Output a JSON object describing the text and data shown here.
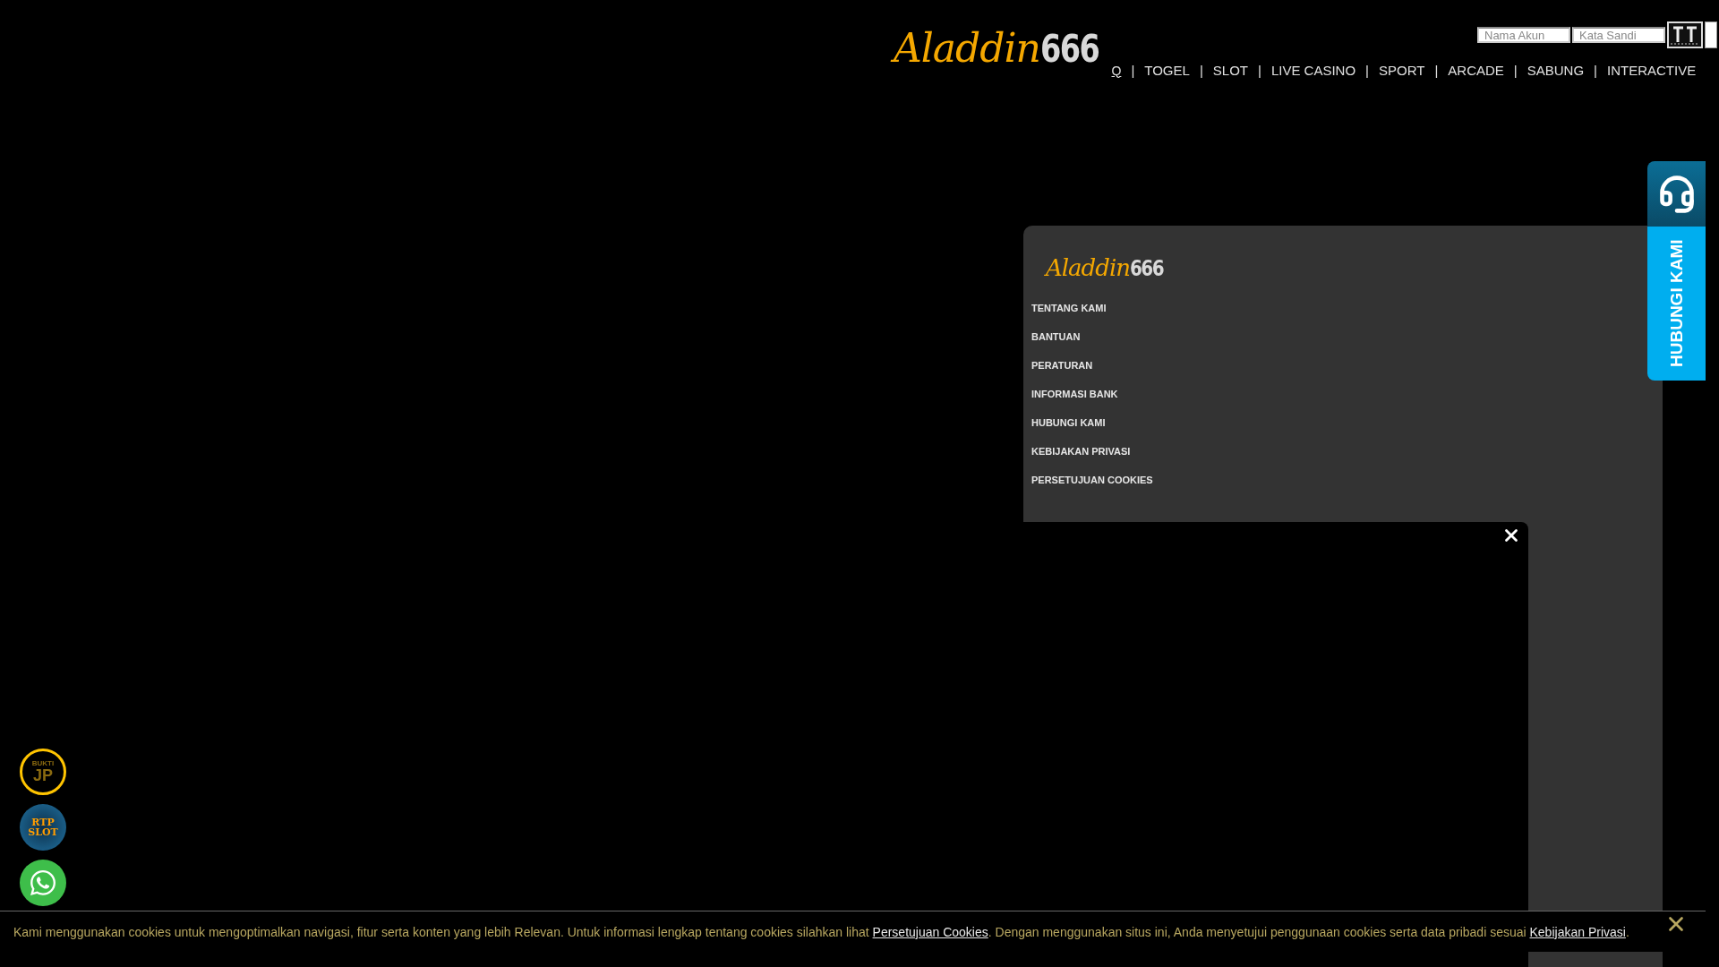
{
  "header": {
    "logo": {
      "script": "Aladdin",
      "number": "666"
    },
    "login": {
      "username_placeholder": "Nama Akun",
      "password_placeholder": "Kata Sandi"
    },
    "nav": [
      {
        "kind": "link",
        "label": "Q"
      },
      {
        "kind": "separator",
        "label": "|"
      },
      {
        "kind": "link",
        "label": "TOGEL"
      },
      {
        "kind": "separator",
        "label": "|"
      },
      {
        "kind": "link",
        "label": "SLOT"
      },
      {
        "kind": "separator",
        "label": "|"
      },
      {
        "kind": "link",
        "label": "LIVE CASINO"
      },
      {
        "kind": "separator",
        "label": "|"
      },
      {
        "kind": "link",
        "label": "SPORT"
      },
      {
        "kind": "separator",
        "label": "|"
      },
      {
        "kind": "link",
        "label": "ARCADE"
      },
      {
        "kind": "separator",
        "label": "|"
      },
      {
        "kind": "link",
        "label": "SABUNG"
      },
      {
        "kind": "separator",
        "label": "|"
      },
      {
        "kind": "link",
        "label": "INTERACTIVE"
      }
    ]
  },
  "footer": {
    "logo": {
      "script": "Aladdin",
      "number": "666"
    },
    "links": [
      "TENTANG KAMI",
      "BANTUAN",
      "PERATURAN",
      "INFORMASI BANK",
      "HUBUNGI KAMI",
      "KEBIJAKAN PRIVASI",
      "PERSETUJUAN COOKIES"
    ]
  },
  "side_tab": {
    "label": "HUBUNGI KAMI"
  },
  "floating_buttons": [
    {
      "kind": "bukti",
      "lines": [
        "BUKTI",
        "JP"
      ]
    },
    {
      "kind": "rtp",
      "lines": [
        "RTP",
        "SLOT"
      ]
    },
    {
      "kind": "whatsapp"
    }
  ],
  "cookie_notice": {
    "segments": [
      {
        "kind": "text",
        "text": "Kami menggunakan cookies untuk mengoptimalkan navigasi, fitur serta konten yang lebih Relevan. Untuk informasi lengkap tentang cookies silahkan lihat "
      },
      {
        "kind": "link",
        "text": "Persetujuan Cookies"
      },
      {
        "kind": "text",
        "text": ". Dengan menggunakan situs ini, Anda menyetujui penggunaan cookies serta data pribadi sesuai "
      },
      {
        "kind": "link",
        "text": "Kebijakan Privasi"
      },
      {
        "kind": "text",
        "text": "."
      }
    ]
  }
}
